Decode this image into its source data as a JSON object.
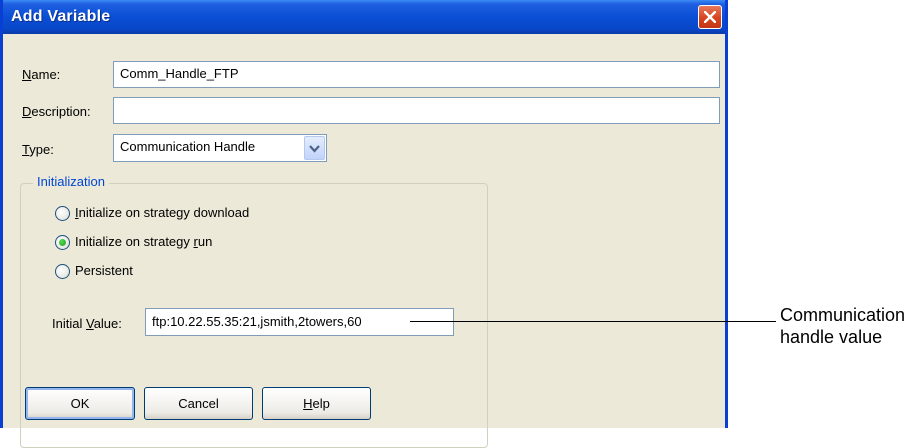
{
  "dialog": {
    "title": "Add Variable",
    "close_icon": "close-x-icon"
  },
  "fields": {
    "name_label_pre": "",
    "name_label_ul": "N",
    "name_label_post": "ame:",
    "name_value": "Comm_Handle_FTP",
    "description_label_ul": "D",
    "description_label_post": "escription:",
    "description_value": "",
    "type_label_ul": "T",
    "type_label_post": "ype:",
    "type_value": "Communication Handle"
  },
  "initialization": {
    "title": "Initialization",
    "options": [
      {
        "pre": "",
        "ul": "I",
        "post": "nitialize on strategy download",
        "selected": false
      },
      {
        "pre": "Initialize on strategy ",
        "ul": "r",
        "post": "un",
        "selected": true
      },
      {
        "pre": "Persistent",
        "ul": "",
        "post": "",
        "selected": false
      }
    ],
    "initial_value_label_pre": "Initial ",
    "initial_value_label_ul": "V",
    "initial_value_label_post": "alue:",
    "initial_value": "ftp:10.22.55.35:21,jsmith,2towers,60"
  },
  "buttons": {
    "ok": "OK",
    "cancel": "Cancel",
    "help_ul": "H",
    "help_post": "elp"
  },
  "callout": {
    "line1": "Communication",
    "line2": "handle value"
  },
  "colors": {
    "titlebar": "#0a4fd6",
    "dialog_bg": "#ece9d8",
    "group_title": "#0046d5"
  }
}
